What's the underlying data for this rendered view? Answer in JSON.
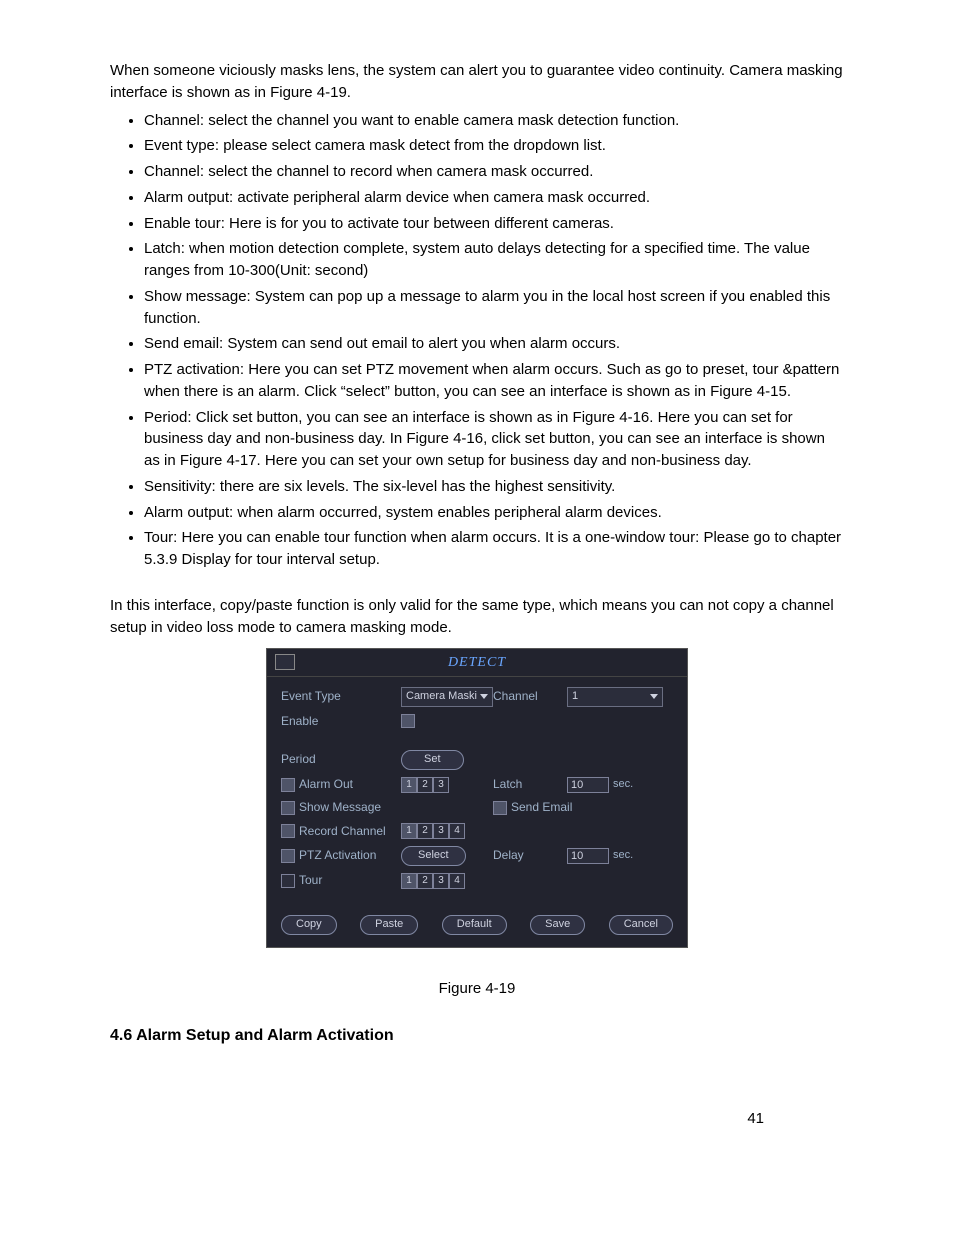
{
  "intro": "When someone viciously masks lens, the system can alert you to guarantee video continuity. Camera masking interface is shown as in Figure 4-19.",
  "bullets": [
    "Channel: select the channel you want to enable camera mask detection function.",
    "Event type: please select camera mask detect from the dropdown list.",
    "Channel: select the channel to record when camera mask occurred.",
    "Alarm output: activate peripheral alarm device when camera mask occurred.",
    "Enable tour: Here is for you to activate tour between different cameras.",
    "Latch: when motion detection complete, system auto delays detecting for a specified time. The value ranges from 10-300(Unit: second)",
    "Show message: System can pop up a message to alarm you in the local host screen if you enabled this function.",
    "Send email: System can send out email to alert you when alarm occurs.",
    "PTZ activation: Here you can set PTZ movement when alarm occurs. Such as go to preset, tour &pattern when there is an alarm. Click “select” button, you can see an interface is shown as in Figure 4-15.",
    "Period: Click set button, you can see an interface is shown as in Figure 4-16. Here you can set for business day and non-business day. In Figure 4-16, click set button, you can see an interface is shown as in Figure 4-17. Here you can set your own setup for business day and non-business day.",
    "Sensitivity: there are six levels. The six-level has the highest sensitivity.",
    "Alarm output: when alarm occurred, system enables peripheral alarm devices.",
    "Tour:  Here you can enable tour function when alarm occurs.  It is a one-window tour: Please go to chapter 5.3.9 Display for tour interval setup."
  ],
  "below": "In this interface, copy/paste function is only valid for the same type, which means you can not copy a channel setup in video loss mode to camera masking mode.",
  "fig": {
    "title": "DETECT",
    "labels": {
      "eventType": "Event Type",
      "channel": "Channel",
      "enable": "Enable",
      "period": "Period",
      "alarmOut": "Alarm Out",
      "latch": "Latch",
      "showMsg": "Show Message",
      "sendEmail": "Send Email",
      "recordCh": "Record Channel",
      "ptz": "PTZ Activation",
      "delay": "Delay",
      "tour": "Tour"
    },
    "values": {
      "eventType": "Camera Maski",
      "channel": "1",
      "latch": "10",
      "delay": "10",
      "unit": "sec."
    },
    "alarmOutBoxes": [
      "1",
      "2",
      "3"
    ],
    "recordBoxes": [
      "1",
      "2",
      "3",
      "4"
    ],
    "tourBoxes": [
      "1",
      "2",
      "3",
      "4"
    ],
    "buttons": {
      "set": "Set",
      "select": "Select",
      "copy": "Copy",
      "paste": "Paste",
      "default": "Default",
      "save": "Save",
      "cancel": "Cancel"
    }
  },
  "caption": "Figure 4-19",
  "section": "4.6  Alarm Setup and Alarm Activation",
  "pageNumber": "41"
}
